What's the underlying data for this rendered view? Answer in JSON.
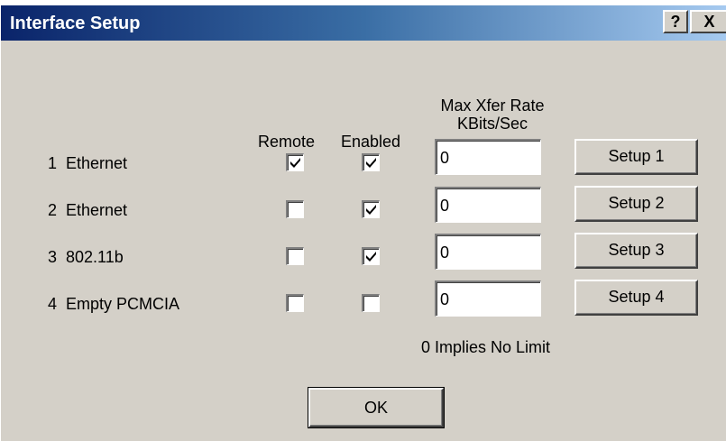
{
  "window": {
    "title": "Interface Setup",
    "help_button": "?",
    "close_button": "X"
  },
  "headers": {
    "remote": "Remote",
    "enabled": "Enabled",
    "rate_line1": "Max Xfer Rate",
    "rate_line2": "KBits/Sec"
  },
  "rows": [
    {
      "name": "1  Ethernet",
      "remote": true,
      "enabled": true,
      "rate": "0",
      "setup_label": "Setup 1"
    },
    {
      "name": "2  Ethernet",
      "remote": false,
      "enabled": true,
      "rate": "0",
      "setup_label": "Setup 2"
    },
    {
      "name": "3  802.11b",
      "remote": false,
      "enabled": true,
      "rate": "0",
      "setup_label": "Setup 3"
    },
    {
      "name": "4  Empty PCMCIA",
      "remote": false,
      "enabled": false,
      "rate": "0",
      "setup_label": "Setup 4"
    }
  ],
  "note": "0 Implies No Limit",
  "ok_label": "OK",
  "colors": {
    "title_gradient_start": "#0a246a",
    "title_gradient_end": "#a6caf0",
    "dialog_face": "#d4d0c8"
  }
}
